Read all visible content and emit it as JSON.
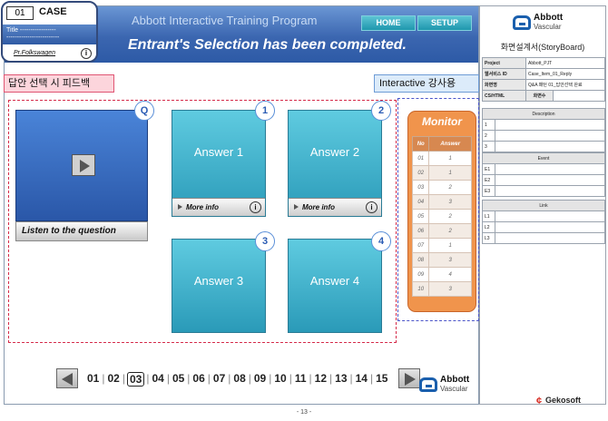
{
  "header": {
    "program_title": "Abbott Interactive Training Program",
    "status": "Entrant's Selection has been completed.",
    "home_label": "HOME",
    "setup_label": "SETUP"
  },
  "case_card": {
    "number": "01",
    "label": "CASE",
    "title_line": "Title  -----------------",
    "title_line2": "-------------------------",
    "author": "Pr.Folkswagen",
    "info_glyph": "i"
  },
  "labels": {
    "feedback": "답안 선택 시 피드백",
    "instructor": "Interactive 강사용"
  },
  "question": {
    "badge": "Q",
    "caption": "Listen to the question"
  },
  "answers": [
    {
      "badge": "1",
      "label": "Answer 1",
      "more_info": "More info",
      "info_glyph": "i"
    },
    {
      "badge": "2",
      "label": "Answer 2",
      "more_info": "More info",
      "info_glyph": "i"
    },
    {
      "badge": "3",
      "label": "Answer 3"
    },
    {
      "badge": "4",
      "label": "Answer 4"
    }
  ],
  "monitor": {
    "title": "Monitor",
    "headers": [
      "No",
      "Answer"
    ],
    "rows": [
      [
        "01",
        "1"
      ],
      [
        "02",
        "1"
      ],
      [
        "03",
        "2"
      ],
      [
        "04",
        "3"
      ],
      [
        "05",
        "2"
      ],
      [
        "06",
        "2"
      ],
      [
        "07",
        "1"
      ],
      [
        "08",
        "3"
      ],
      [
        "09",
        "4"
      ],
      [
        "10",
        "3"
      ]
    ]
  },
  "pagination": {
    "pages": [
      "01",
      "02",
      "03",
      "04",
      "05",
      "06",
      "07",
      "08",
      "09",
      "10",
      "11",
      "12",
      "13",
      "14",
      "15"
    ],
    "current": "03",
    "separator": "|"
  },
  "logo": {
    "name": "Abbott",
    "sub": "Vascular"
  },
  "page_number": "- 13 -",
  "storyboard": {
    "title": "화면설계서(StoryBoard)",
    "rows": [
      {
        "key": "Project",
        "value": "Abbott_PJT"
      },
      {
        "key": "웹서비스 ID",
        "value": "Case_Item_01_Reply"
      },
      {
        "key": "화면명",
        "value": "Q&A 패턴 01_답안선택 완료"
      },
      {
        "key": "CS/HTML",
        "value": "",
        "extra": "화면수"
      }
    ],
    "description": {
      "title": "Description",
      "rows": [
        "1",
        "2",
        "3"
      ]
    },
    "event": {
      "title": "Event",
      "rows": [
        "E1",
        "E2",
        "E3"
      ]
    },
    "link": {
      "title": "Link",
      "rows": [
        "L1",
        "L2",
        "L3"
      ]
    }
  },
  "vendor": {
    "name": "Gekosoft",
    "mark": "¢"
  }
}
